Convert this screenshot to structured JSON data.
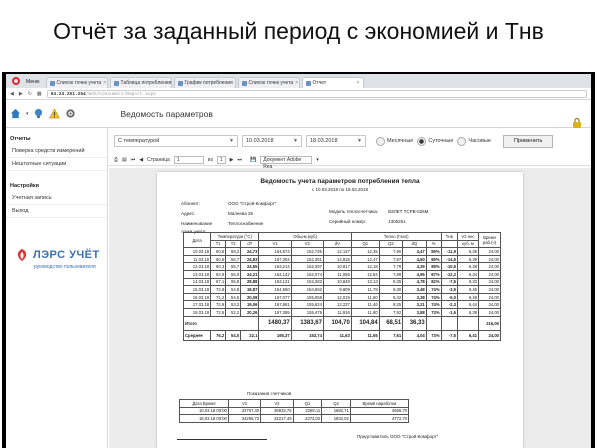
{
  "slide_title": "Отчёт за заданный период с экономией и Тнв",
  "browser": {
    "menu_label": "Меню",
    "tabs": [
      "Список точек учета",
      "Таблица потребления",
      "График потребления",
      "Список точек учета",
      "Отчет"
    ],
    "address_ip": "94.24.251.254",
    "address_path": "/Web/Consumers/Report.aspx"
  },
  "page_header": "Ведомость параметров",
  "sidebar": {
    "sections": [
      {
        "title": "Отчеты",
        "items": [
          "Поверка средств измерений",
          "Нештатные ситуации"
        ]
      },
      {
        "title": "Настройки",
        "items": [
          "Учетная запись",
          "Выход"
        ]
      }
    ],
    "logo_text": "ЛЭРС УЧЁТ",
    "logo_sub": "руководство пользователя"
  },
  "controls": {
    "report_type": "С температурой",
    "date_from": "10.03.2018",
    "date_to": "18.03.2018",
    "radio_monthly": "Месячные",
    "radio_daily": "Суточные",
    "radio_hourly": "Часовые",
    "apply": "Применить"
  },
  "toolbar": {
    "page_label": "Страница",
    "page_num": "1",
    "of_label": "из",
    "total": "1",
    "format": "Документ Adobe Rea"
  },
  "report": {
    "title": "Ведомость учета параметров потребления тепла",
    "period": "с 10.03.2018 по 18.03.2018",
    "info_left": [
      [
        "Абонент:",
        "ООО \"Строй-Комфорт\""
      ],
      [
        "Адрес:",
        "Малеева 26"
      ],
      [
        "Наименование точки учета:",
        "Теплоснабжение"
      ]
    ],
    "info_right": [
      [
        "Модель теплосчетчика:",
        "ВЗЛЕТ ТСРВ-026М"
      ],
      [
        "Серийный номер:",
        "1305261"
      ]
    ],
    "headers": {
      "date": "Дата",
      "temp": "Температура (°С)",
      "volume": "Объем (куб)",
      "heat": "Тепло (Гкал)",
      "tnv": "Тнв",
      "v2": "V2 нес",
      "time": "Время раб.(ч)",
      "sub": [
        "Т1",
        "Т2",
        "dT",
        "V1",
        "V2",
        "dV",
        "Q1",
        "Q2",
        "dQ",
        "%",
        "",
        "куб. м",
        ""
      ]
    },
    "rows": [
      [
        "10.03.18",
        "60,6",
        "58,2",
        "24,73",
        "164,673",
        "152,735",
        "12,137",
        "12,35",
        "7,90",
        "4,47",
        "89%",
        "-11,9",
        "6,36",
        "24,00"
      ],
      [
        "11.03.18",
        "60,5",
        "55,7",
        "24,83",
        "167,304",
        "152,351",
        "14,816",
        "12,47",
        "7,87",
        "4,60",
        "89%",
        "-14,6",
        "6,39",
        "24,00"
      ],
      [
        "12.03.18",
        "60,3",
        "55,7",
        "24,55",
        "163,214",
        "152,397",
        "10,817",
        "12,18",
        "7,79",
        "4,39",
        "89%",
        "-10,6",
        "6,38",
        "24,00"
      ],
      [
        "13.03.18",
        "62,9",
        "55,9",
        "24,21",
        "164,142",
        "152,074",
        "11,066",
        "12,84",
        "7,89",
        "4,95",
        "87%",
        "-12,2",
        "6,34",
        "24,00"
      ],
      [
        "14.03.18",
        "67,1",
        "55,8",
        "28,88",
        "163,131",
        "152,283",
        "10,848",
        "13,13",
        "8,35",
        "4,78",
        "82%",
        "-7,5",
        "6,33",
        "24,00"
      ],
      [
        "15.03.18",
        "72,8",
        "54,8",
        "18,87",
        "164,550",
        "154,692",
        "9,809",
        "11,78",
        "8,30",
        "3,48",
        "74%",
        "-3,5",
        "6,46",
        "24,00"
      ],
      [
        "16.03.18",
        "71,2",
        "54,5",
        "20,08",
        "167,077",
        "155,058",
        "12,019",
        "11,80",
        "8,42",
        "3,38",
        "74%",
        "-5,0",
        "6,48",
        "24,00"
      ],
      [
        "17.03.18",
        "72,9",
        "53,2",
        "19,06",
        "167,861",
        "155,624",
        "12,237",
        "11,46",
        "8,25",
        "3,21",
        "74%",
        "-2,3",
        "6,44",
        "24,00"
      ],
      [
        "18.03.18",
        "72,5",
        "52,2",
        "20,26",
        "167,395",
        "155,479",
        "11,916",
        "11,80",
        "7,92",
        "3,88",
        "73%",
        "-1,6",
        "6,39",
        "24,00"
      ]
    ],
    "total": [
      "Итого",
      "",
      "",
      "",
      "1480,37",
      "1383,67",
      "104,70",
      "104,84",
      "68,51",
      "36,33",
      "",
      "",
      "",
      "216,00"
    ],
    "average": [
      "Среднее",
      "76,2",
      "54,0",
      "22,1",
      "165,37",
      "153,74",
      "11,63",
      "11,65",
      "7,61",
      "4,04",
      "73%",
      "-7,5",
      "6,41",
      "24,00"
    ],
    "meters_caption": "Показания счетчиков",
    "meters_headers": [
      "Дата Время",
      "V1",
      "V2",
      "Q1",
      "Q2",
      "Время наработки"
    ],
    "meters_rows": [
      [
        "10.03.18 00:00",
        "32767,40",
        "36833,75",
        "2268,11",
        "1682,71",
        "4556,70"
      ],
      [
        "18.03.18 00:00",
        "34256,72",
        "32217,49",
        "2373,02",
        "1832,02",
        "4772,70"
      ]
    ],
    "signature": "Представитель ООО \"Строй-Комфорт\""
  }
}
